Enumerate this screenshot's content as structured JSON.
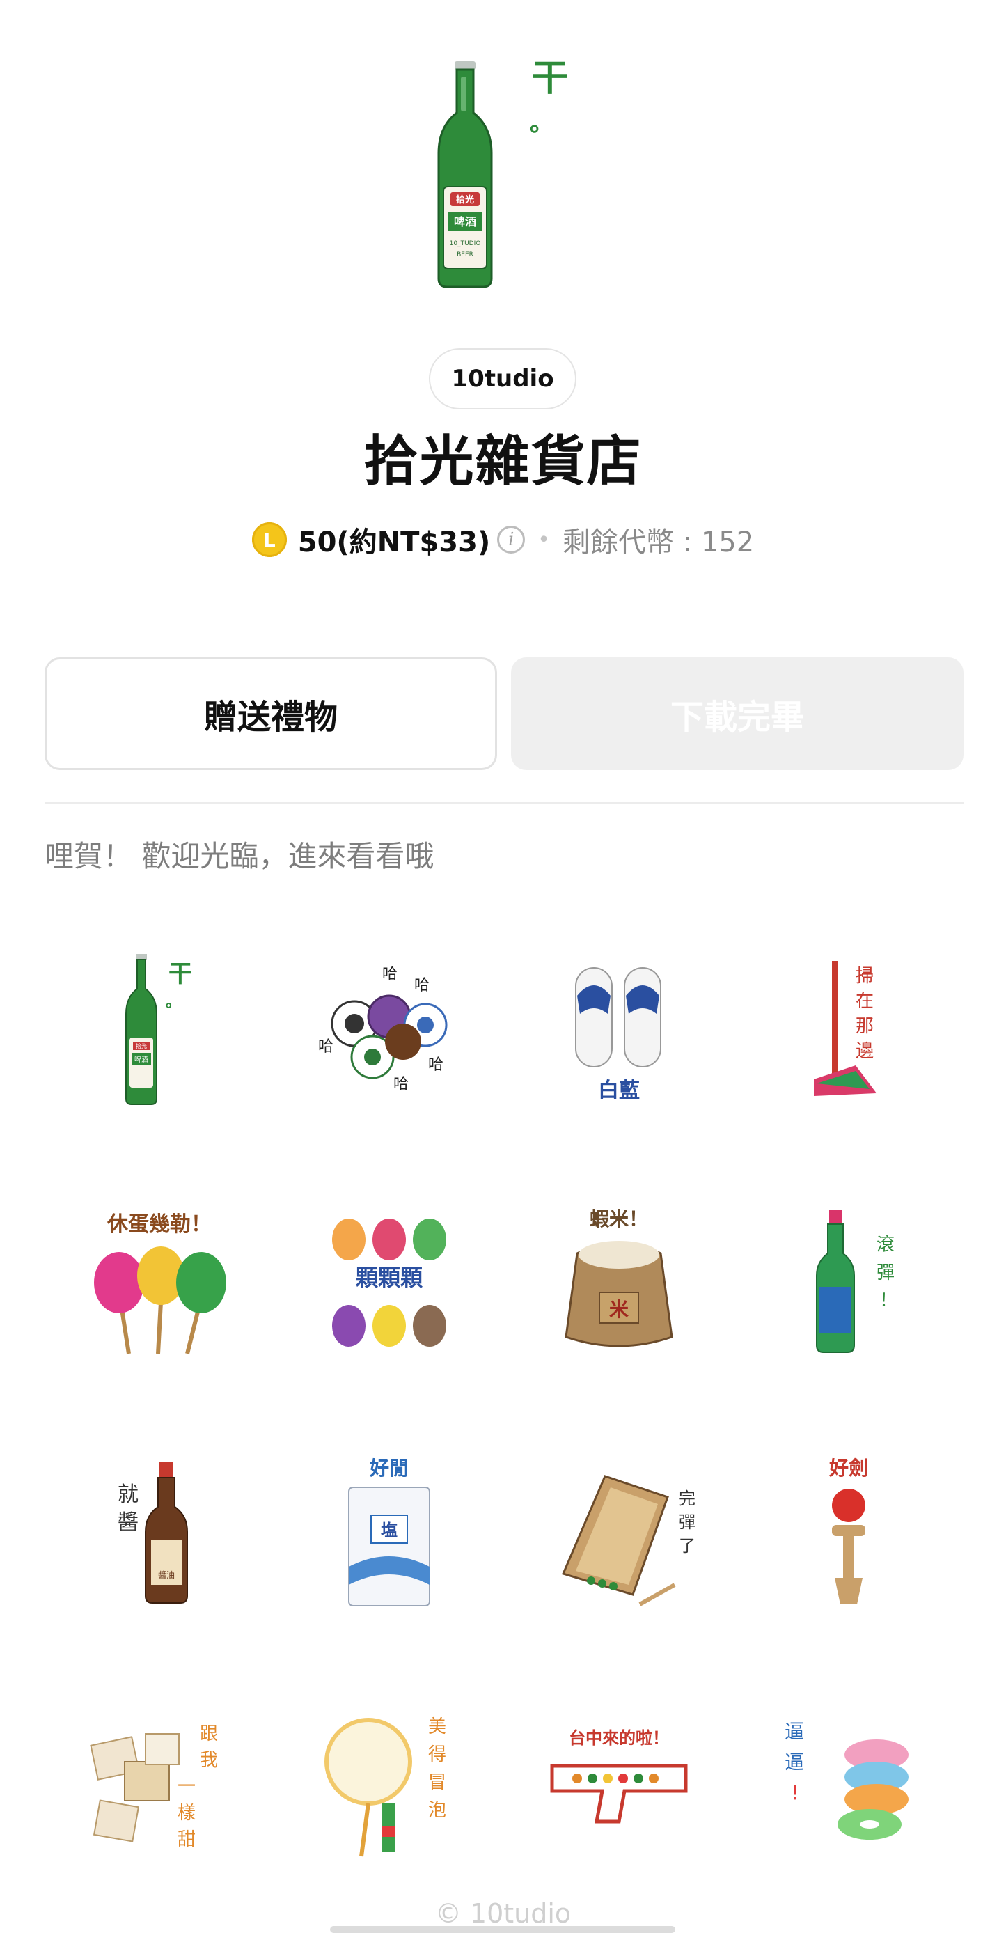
{
  "product": {
    "author": "10tudio",
    "title": "拾光雜貨店",
    "coin_symbol": "L",
    "price": "50(約NT$33)",
    "info_glyph": "i",
    "separator": "•",
    "remaining_coins": "剩餘代幣 : 152",
    "hero_bottle": {
      "label_top": "拾光",
      "label_mid": "啤酒",
      "label_sub": "10_TUDIO",
      "label_bottom": "BEER",
      "exclaim": "干",
      "exclaim_dot": "。"
    }
  },
  "actions": {
    "gift_label": "贈送禮物",
    "download_label": "下載完畢"
  },
  "description": "哩賀！ 歡迎光臨，進來看看哦",
  "stickers": [
    {
      "name": "beer-bottle",
      "texts": [
        "干",
        "。",
        "拾光",
        "啤酒"
      ]
    },
    {
      "name": "marbles-laughing",
      "texts": [
        "哈",
        "哈",
        "哈",
        "哈",
        "哈"
      ]
    },
    {
      "name": "slippers",
      "texts": [
        "白藍"
      ]
    },
    {
      "name": "broom",
      "texts": [
        "掃",
        "在",
        "那",
        "邊"
      ]
    },
    {
      "name": "lollipops",
      "texts": [
        "休蛋幾勒！"
      ]
    },
    {
      "name": "candies",
      "texts": [
        "顆顆顆"
      ]
    },
    {
      "name": "rice-sack",
      "texts": [
        "蝦米！",
        "米"
      ]
    },
    {
      "name": "soda-bottle",
      "texts": [
        "滾",
        "彈",
        "！"
      ]
    },
    {
      "name": "soy-sauce",
      "texts": [
        "就",
        "醬",
        "醬油"
      ]
    },
    {
      "name": "salt-bag",
      "texts": [
        "好閒",
        "塩"
      ]
    },
    {
      "name": "pinball-board",
      "texts": [
        "完",
        "彈",
        "了"
      ]
    },
    {
      "name": "kendama",
      "texts": [
        "好劍"
      ]
    },
    {
      "name": "candy-wrappers",
      "texts": [
        "跟",
        "我",
        "一",
        "樣",
        "甜"
      ]
    },
    {
      "name": "bubble-wand",
      "texts": [
        "美",
        "得",
        "冒",
        "泡"
      ]
    },
    {
      "name": "toy-gun",
      "texts": [
        "台中來的啦！"
      ]
    },
    {
      "name": "candy-stack",
      "texts": [
        "逼",
        "逼",
        "！"
      ]
    }
  ],
  "footer": "© 10tudio",
  "colors": {
    "coin": "#f4c51a",
    "bottle_green": "#2e8b3a",
    "muted_text": "#8a8a8a",
    "disabled_button_bg": "#efefef"
  }
}
